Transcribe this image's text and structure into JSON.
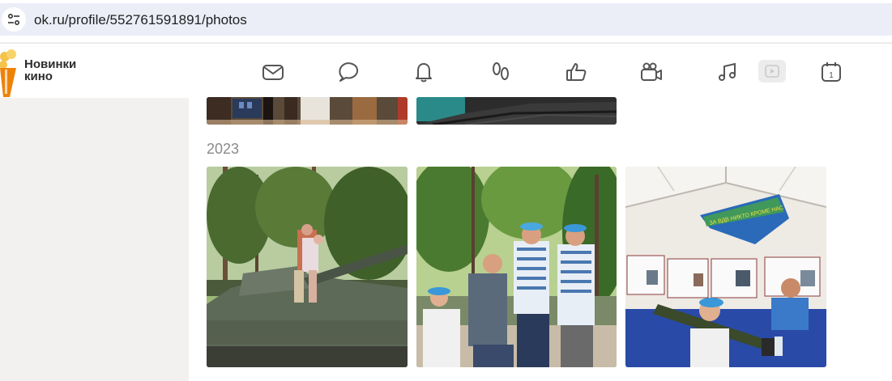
{
  "browser": {
    "url": "ok.ru/profile/552761591891/photos"
  },
  "header": {
    "promo_line1": "Новинки",
    "promo_line2": "кино",
    "nav_icons": [
      "mail-icon",
      "chat-icon",
      "bell-icon",
      "footprints-icon",
      "like-icon",
      "video-camera-icon",
      "music-note-icon",
      "calendar-icon"
    ],
    "calendar_day": "1"
  },
  "gallery": {
    "year_label": "2023",
    "photos_top_row": [
      "photo-crop-1",
      "photo-crop-2"
    ],
    "photos_2023": [
      "tank-photo",
      "blue-berets-photo",
      "exhibition-tent-photo"
    ],
    "flag_text": "ЗА ВДВ НИКТО КРОМЕ НАС"
  },
  "colors": {
    "accent_orange": "#ee8208",
    "urlbar_bg": "#ebeef7",
    "sidebar_bg": "#f3f1ef"
  }
}
